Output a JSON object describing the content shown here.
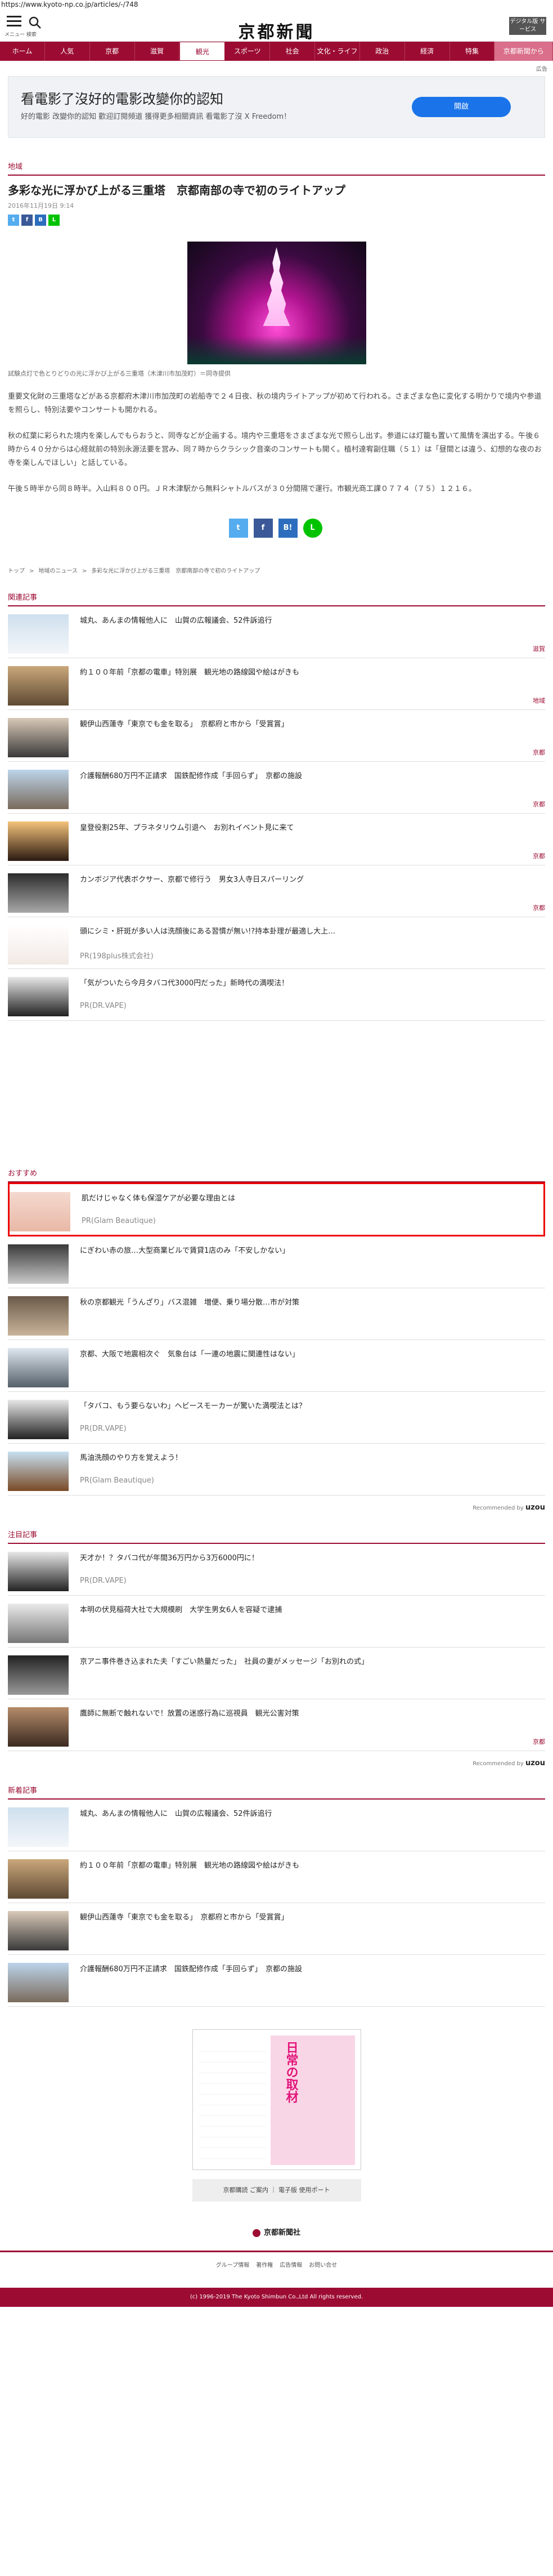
{
  "url": "https://www.kyoto-np.co.jp/articles/-/748",
  "header": {
    "sub": "メニュー 検索",
    "logo": "京都新聞",
    "button": "デジタル版 サービス"
  },
  "nav": [
    "ホーム",
    "人気",
    "京都",
    "滋賀",
    "観光",
    "スポーツ",
    "社会",
    "文化・ライフ",
    "政治",
    "経済",
    "特集",
    "京都新聞から"
  ],
  "ad": {
    "label": "広告",
    "title": "看電影了沒好的電影改變你的認知",
    "desc": "好的電影 改變你的認知 歡迎訂閱頻道 獲得更多相關資訊 看電影了沒 X Freedom！",
    "button": "開啟"
  },
  "article": {
    "category": "地域",
    "title": "多彩な光に浮かび上がる三重塔　京都南部の寺で初のライトアップ",
    "date": "2016年11月19日 9:14",
    "caption": "試験点灯で色とりどりの光に浮かび上がる三重塔（木津川市加茂町）＝同寺提供",
    "p1": "重要文化財の三重塔などがある京都府木津川市加茂町の岩船寺で２４日夜、秋の境内ライトアップが初めて行われる。さまざまな色に変化する明かりで境内や参道を照らし、特別法要やコンサートも開かれる。",
    "p2": "秋の紅葉に彩られた境内を楽しんでもらおうと、同寺などが企画する。境内や三重塔をさまざまな光で照らし出す。参道には灯籠も置いて風情を演出する。午後６時から４０分からは心経就前の特別永源法要を営み、同７時からクラシック音楽のコンサートも開く。植村達宥副住職（５１）は「昼間とは違う、幻想的な夜のお寺を楽しんでほしい」と話している。",
    "p3": "午後５時半から同８時半。入山料８００円。ＪＲ木津駅から無料シャトルバスが３０分間隔で運行。市観光商工課０７７４（７５）１２１６。"
  },
  "crumbs": [
    "トップ",
    "地域のニュース",
    "多彩な光に浮かび上がる三重塔　京都南部の寺で初のライトアップ"
  ],
  "related": {
    "heading": "関連記事",
    "items": [
      {
        "title": "城丸、あんまの情報他人に　山賀の広報議会、52件訴追行",
        "tag": "滋賀"
      },
      {
        "title": "約１００年前「京都の電車」特別展　観光地の路線図や絵はがきも",
        "tag": "地域"
      },
      {
        "title": "観伊山西蓮寺「東京でも金を取る」　京都府と市から「受賞賞」",
        "tag": "京都"
      },
      {
        "title": "介護報酬680万円不正請求　国鉄配修作成「手回らず」　京都の施設",
        "tag": "京都"
      },
      {
        "title": "皇登役割25年、プラネタリウム引退へ　お別れイベント見に来て",
        "tag": "京都"
      },
      {
        "title": "カンボジア代表ボクサー、京都で修行う　男女3人寺日スパーリング",
        "tag": "京都"
      },
      {
        "title": "頭にシミ・肝斑が多い人は洗顔後にある習慣が無い!?持本卦理が最適し大上…",
        "src": "PR(198plus株式会社)"
      },
      {
        "title": "「気がついたら今月タバコ代3000円だった」新時代の満喫法！",
        "src": "PR(DR.VAPE)"
      }
    ]
  },
  "recommend": {
    "heading": "おすすめ",
    "items": [
      {
        "title": "肌だけじゃなく体も保湿ケアが必要な理由とは",
        "src": "PR(Glam Beautique)"
      },
      {
        "title": "にぎわい赤の旅…大型商業ビルで賃貸1店のみ「不安しかない」"
      },
      {
        "title": "秋の京都観光「うんざり」バス混雑　増便、乗り場分散…市が対策"
      },
      {
        "title": "京都、大阪で地震相次ぐ　気象台は「一連の地震に関連性はない」"
      },
      {
        "title": "「タバコ、もう要らないわ」ヘビースモーカーが驚いた満喫法とは？",
        "src": "PR(DR.VAPE)"
      },
      {
        "title": "馬油洗顔のやり方を覚えよう！",
        "src": "PR(Glam Beautique)"
      }
    ],
    "credit": "Recommended by",
    "brand": "uzou"
  },
  "featured": {
    "heading": "注目記事",
    "items": [
      {
        "title": "天才か！？タバコ代が年間36万円から3万6000円に！",
        "src": "PR(DR.VAPE)"
      },
      {
        "title": "本明の伏見稲荷大社で大規模刷　大学生男女6人を容疑で逮捕"
      },
      {
        "title": "京アニ事件巻き込まれた夫「すごい熱量だった」　社員の妻がメッセージ「お別れの式」"
      },
      {
        "title": "鷹師に無断で触れないで！放置の迷惑行為に巡視員　観光公害対策",
        "tag": "京都"
      }
    ],
    "credit": "Recommended by",
    "brand": "uzou"
  },
  "latest": {
    "heading": "新着記事",
    "items": [
      {
        "title": "城丸、あんまの情報他人に　山賀の広報議会、52件訴追行"
      },
      {
        "title": "約１００年前「京都の電車」特別展　観光地の路線図や絵はがきも"
      },
      {
        "title": "観伊山西蓮寺「東京でも金を取る」　京都府と市から「受賞賞」"
      },
      {
        "title": "介護報酬680万円不正請求　国鉄配修作成「手回らず」　京都の施設"
      }
    ]
  },
  "bottom": {
    "ad_text": "日常の取材",
    "links": "京都購読 ご案内 ｜ 電子版 使用ポート",
    "footer_logo": "京都新聞社",
    "footer_links": [
      "グループ情報",
      "著作権",
      "広告情報",
      "お問い合せ"
    ],
    "copyright": "(c) 1996-2019 The Kyoto Shimbun Co.,Ltd All rights reserved."
  },
  "colors": {
    "brand": "#9c0c32",
    "highlight": "#e00000"
  }
}
